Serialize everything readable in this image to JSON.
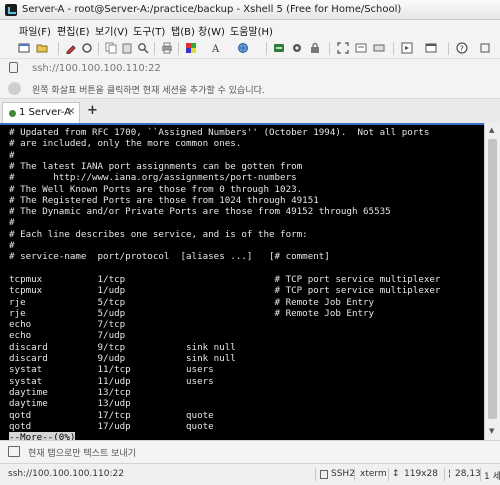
{
  "window": {
    "title": "Server-A - root@Server-A:/practice/backup - Xshell 5 (Free for Home/School)"
  },
  "menu": [
    "파일(F)",
    "편집(E)",
    "보기(V)",
    "도구(T)",
    "탭(B)",
    "창(W)",
    "도움말(H)"
  ],
  "toolbar": {
    "icons": [
      "new-session-icon",
      "open-folder-icon",
      "properties-icon",
      "reconnect-icon",
      "copy-icon",
      "paste-icon",
      "find-icon",
      "print-icon",
      "color-scheme-icon",
      "font-icon",
      "globe-icon",
      "xftp-icon",
      "lock-icon",
      "fullscreen-icon",
      "compose-icon",
      "keyboard-icon",
      "layout-icon",
      "help-icon"
    ]
  },
  "address": {
    "text": "ssh://100.100.100.110:22"
  },
  "hint": {
    "text": "왼쪽 화살표 버튼을 클릭하면 현재 세션을 추가할 수 있습니다."
  },
  "tabs": [
    {
      "label": "1 Server-A",
      "close": "×"
    }
  ],
  "tab_add": "+",
  "terminal": {
    "lines": [
      "# Updated from RFC 1700, ``Assigned Numbers'' (October 1994).  Not all ports",
      "# are included, only the more common ones.",
      "#",
      "# The latest IANA port assignments can be gotten from",
      "#       http://www.iana.org/assignments/port-numbers",
      "# The Well Known Ports are those from 0 through 1023.",
      "# The Registered Ports are those from 1024 through 49151",
      "# The Dynamic and/or Private Ports are those from 49152 through 65535",
      "#",
      "# Each line describes one service, and is of the form:",
      "#",
      "# service-name  port/protocol  [aliases ...]   [# comment]",
      "",
      "tcpmux          1/tcp                           # TCP port service multiplexer",
      "tcpmux          1/udp                           # TCP port service multiplexer",
      "rje             5/tcp                           # Remote Job Entry",
      "rje             5/udp                           # Remote Job Entry",
      "echo            7/tcp",
      "echo            7/udp",
      "discard         9/tcp           sink null",
      "discard         9/udp           sink null",
      "systat          11/tcp          users",
      "systat          11/udp          users",
      "daytime         13/tcp",
      "daytime         13/udp",
      "qotd            17/tcp          quote",
      "qotd            17/udp          quote"
    ],
    "more_prompt": "--More--(0%)"
  },
  "compose": {
    "text": "현재 탭으로만 텍스트 보내기"
  },
  "status": {
    "address": "ssh://100.100.100.110:22",
    "protocol": "SSH2",
    "terminal_type": "xterm",
    "size": "119x28",
    "cursor": "28,13",
    "sessions": "1 세"
  }
}
